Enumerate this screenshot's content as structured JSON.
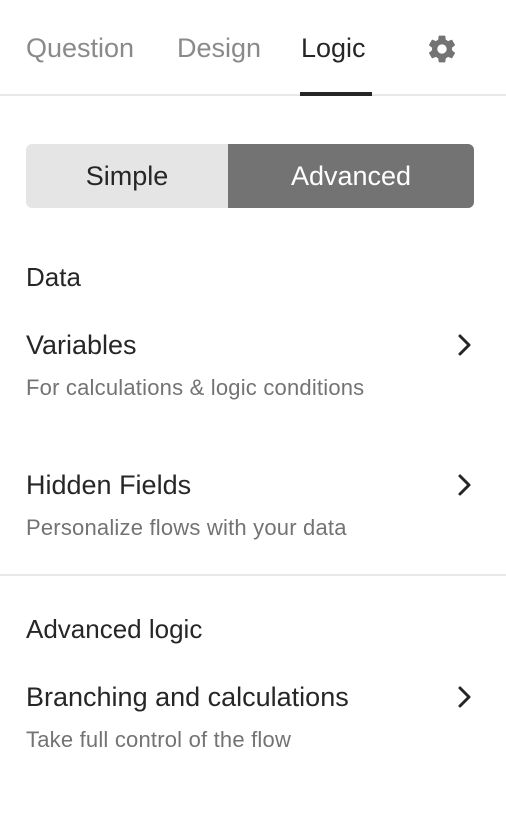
{
  "tabs": [
    {
      "label": "Question",
      "active": false
    },
    {
      "label": "Design",
      "active": false
    },
    {
      "label": "Logic",
      "active": true
    }
  ],
  "settings_icon": "gear-icon",
  "mode_toggle": {
    "options": [
      "Simple",
      "Advanced"
    ],
    "selected": "Advanced"
  },
  "sections": [
    {
      "heading": "Data",
      "items": [
        {
          "title": "Variables",
          "description": "For calculations & logic conditions",
          "icon": "chevron-right-icon"
        },
        {
          "title": "Hidden Fields",
          "description": "Personalize flows with your data",
          "icon": "chevron-right-icon"
        }
      ]
    },
    {
      "heading": "Advanced logic",
      "items": [
        {
          "title": "Branching and calculations",
          "description": "Take full control of the flow",
          "icon": "chevron-right-icon"
        }
      ]
    }
  ],
  "colors": {
    "text_primary": "#262627",
    "text_muted": "#737373",
    "tab_inactive": "#8a8a8a",
    "segment_selected_bg": "#737373",
    "segment_unselected_bg": "#e5e5e5",
    "divider": "#e8e8e8"
  }
}
